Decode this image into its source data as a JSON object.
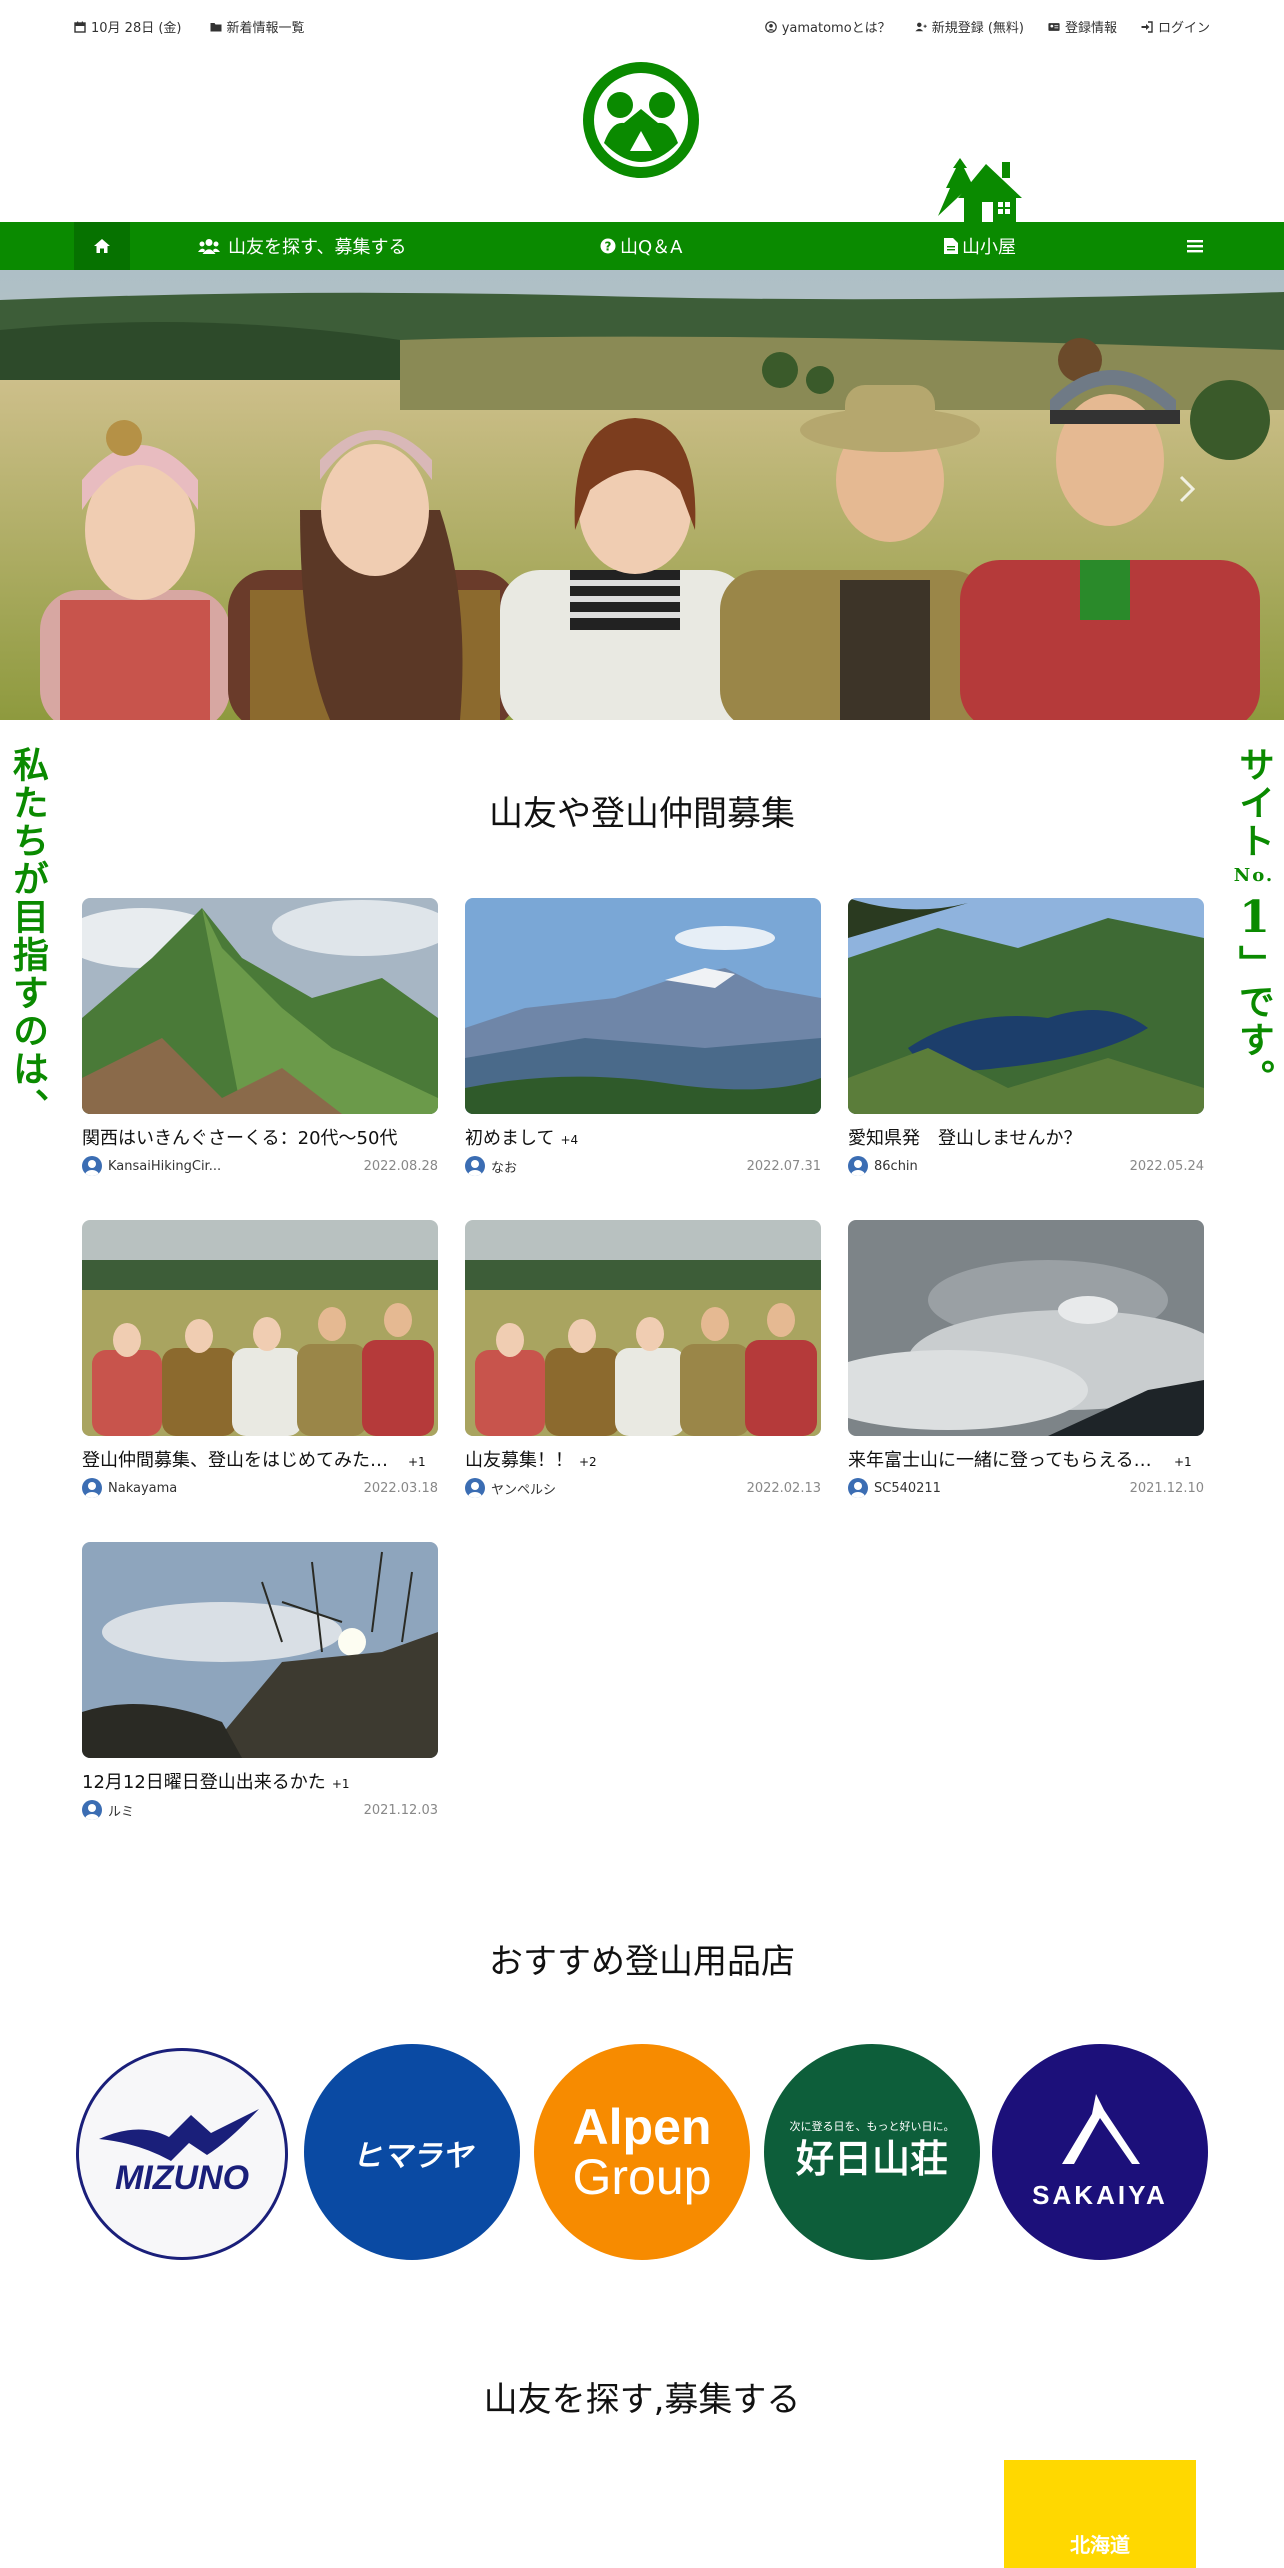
{
  "topbar": {
    "date": "10月 28日 (金)",
    "news": "新着情報一覧",
    "about": "yamatomoとは？",
    "register": "新規登録 (無料)",
    "profile": "登録情報",
    "login": "ログイン"
  },
  "nav": {
    "find": "山友を探す、募集する",
    "qa": "山Q＆A",
    "hut": "山小屋"
  },
  "side": {
    "left": "私たちが目指すのは、",
    "right_1": "サイト",
    "right_no": "No.",
    "right_2": "1",
    "right_3": "」です。"
  },
  "section1": {
    "title": "山友や登山仲間募集"
  },
  "posts": [
    {
      "title": "関西はいきんぐさーくる：20代～50代",
      "plus": "",
      "author": "KansaiHikingCir...",
      "date": "2022.08.28"
    },
    {
      "title": "初めまして",
      "plus": "+4",
      "author": "なお",
      "date": "2022.07.31"
    },
    {
      "title": "愛知県発　登山しませんか？",
      "plus": "",
      "author": "86chin",
      "date": "2022.05.24"
    },
    {
      "title": "登山仲間募集、登山をはじめてみたい...",
      "plus": "+1",
      "author": "Nakayama",
      "date": "2022.03.18"
    },
    {
      "title": "山友募集！！",
      "plus": "+2",
      "author": "ヤンペルシ",
      "date": "2022.02.13"
    },
    {
      "title": "来年富士山に一緒に登ってもらえる方...",
      "plus": "+1",
      "author": "SC540211",
      "date": "2021.12.10"
    },
    {
      "title": "12月12日曜日登山出来るかた",
      "plus": "+1",
      "author": "ルミ",
      "date": "2021.12.03"
    }
  ],
  "section2": {
    "title": "おすすめ登山用品店"
  },
  "shops": {
    "mizuno": "MIZUNO",
    "himaraya": "ヒマラヤ",
    "alpen_1": "Alpen",
    "alpen_2": "Group",
    "kojitsu_sub": "次に登る日を、もっと好い日に。",
    "kojitsu": "好日山荘",
    "sakaiya": "SAKAIYA"
  },
  "section3": {
    "title": "山友を探す,募集する"
  },
  "regions": {
    "hokkaido": "北海道"
  },
  "colors": {
    "brand_green": "#0a8a00",
    "hokkaido_yellow": "#ffd800"
  }
}
